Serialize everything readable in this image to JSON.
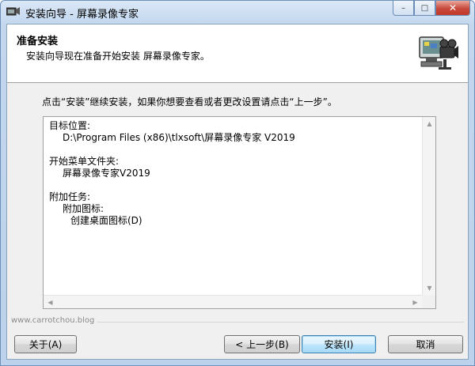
{
  "window": {
    "title": "安装向导 - 屏幕录像专家",
    "controls": {
      "minimize": "–",
      "maximize": "□",
      "close": "✕"
    }
  },
  "header": {
    "title": "准备安装",
    "subtitle": "安装向导现在准备开始安装 屏幕录像专家。",
    "icon": "camera-computer-icon"
  },
  "instruction": "点击“安装”继续安装，如果你想要查看或者更改设置请点击“上一步”。",
  "memo": {
    "dest_label": "目标位置:",
    "dest_value": "D:\\Program Files (x86)\\tlxsoft\\屏幕录像专家 V2019",
    "menu_label": "开始菜单文件夹:",
    "menu_value": "屏幕录像专家V2019",
    "tasks_label": "附加任务:",
    "tasks_sub": "附加图标:",
    "tasks_item": "创建桌面图标(D)"
  },
  "branding": "www.carrotchou.blog",
  "buttons": {
    "about": "关于(A)",
    "back": "< 上一步(B)",
    "install": "安装(I)",
    "cancel": "取消"
  },
  "colors": {
    "titlebar": "#c2d7ee",
    "client": "#f0f0f0",
    "default_button_border": "#3c7fb1"
  }
}
